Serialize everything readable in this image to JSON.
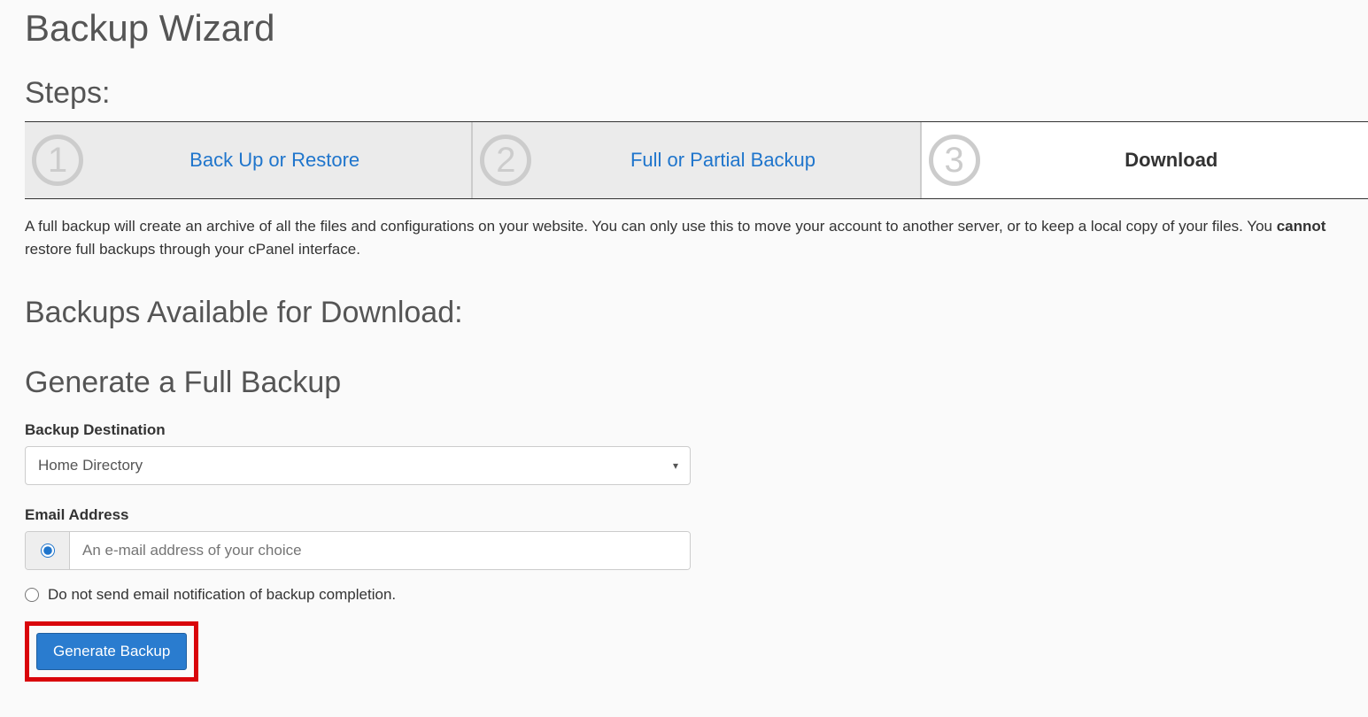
{
  "page": {
    "title": "Backup Wizard",
    "steps_heading": "Steps:"
  },
  "steps": [
    {
      "num": "1",
      "label": "Back Up or Restore",
      "active": false
    },
    {
      "num": "2",
      "label": "Full or Partial Backup",
      "active": false
    },
    {
      "num": "3",
      "label": "Download",
      "active": true
    }
  ],
  "description": {
    "part1": "A full backup will create an archive of all the files and configurations on your website. You can only use this to move your account to another server, or to keep a local copy of your files. You ",
    "strong": "cannot",
    "part2": " restore full backups through your cPanel interface."
  },
  "sections": {
    "available_heading": "Backups Available for Download:",
    "generate_heading": "Generate a Full Backup"
  },
  "form": {
    "destination_label": "Backup Destination",
    "destination_value": "Home Directory",
    "email_label": "Email Address",
    "email_placeholder": "An e-mail address of your choice",
    "no_email_label": "Do not send email notification of backup completion.",
    "generate_button": "Generate Backup"
  }
}
